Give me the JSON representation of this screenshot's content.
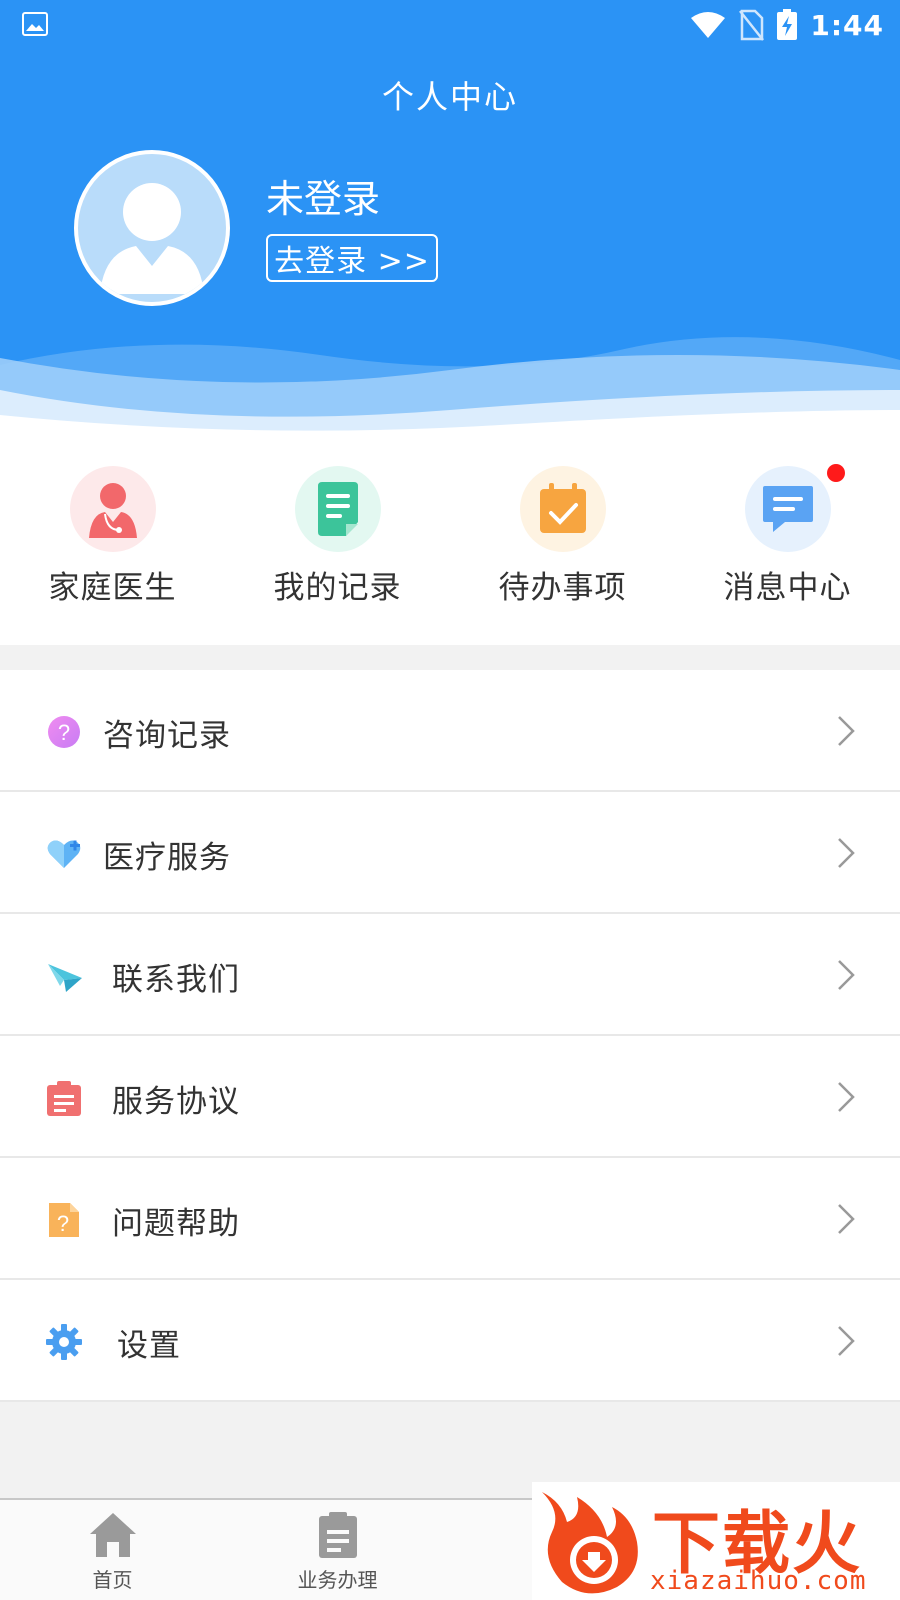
{
  "status_bar": {
    "time": "1:44"
  },
  "header": {
    "title": "个人中心",
    "username": "未登录",
    "login_label": "去登录 >>"
  },
  "quick_actions": [
    {
      "label": "家庭医生",
      "icon": "doctor-icon",
      "color": "#f2686b"
    },
    {
      "label": "我的记录",
      "icon": "record-doc-icon",
      "color": "#3cc49a"
    },
    {
      "label": "待办事项",
      "icon": "calendar-check-icon",
      "color": "#f7a540"
    },
    {
      "label": "消息中心",
      "icon": "message-icon",
      "color": "#5aa3f3",
      "has_unread_dot": true
    }
  ],
  "menu": [
    {
      "label": "咨询记录",
      "icon": "question-bubble-icon"
    },
    {
      "label": "医疗服务",
      "icon": "heart-plus-icon"
    },
    {
      "label": "联系我们",
      "icon": "paper-plane-icon"
    },
    {
      "label": "服务协议",
      "icon": "clipboard-icon"
    },
    {
      "label": "问题帮助",
      "icon": "help-file-icon"
    },
    {
      "label": "设置",
      "icon": "gear-icon"
    }
  ],
  "bottom_nav": [
    {
      "label": "首页",
      "icon": "home-icon"
    },
    {
      "label": "业务办理",
      "icon": "clipboard-icon"
    }
  ],
  "watermark": {
    "main": "下载火",
    "sub": "xiazaihuo.com"
  },
  "colors": {
    "header_blue": "#2b93f5",
    "unread_red": "#ff1a1a"
  }
}
